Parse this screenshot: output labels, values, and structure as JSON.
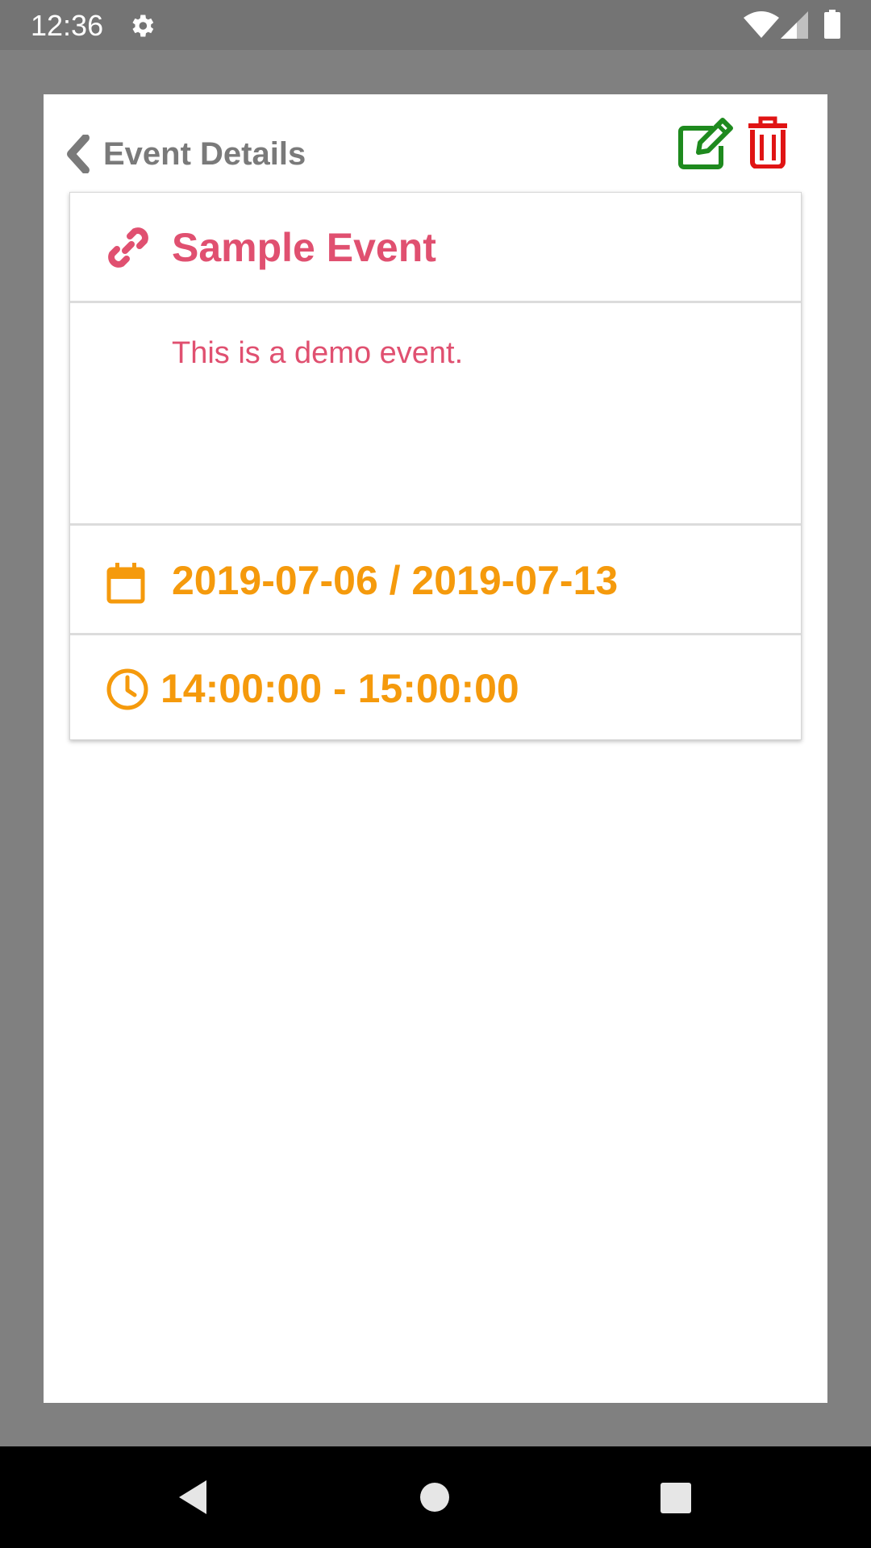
{
  "status_bar": {
    "time": "12:36",
    "icons": [
      "gear-icon",
      "wifi-icon",
      "signal-icon",
      "battery-icon"
    ]
  },
  "header": {
    "back_icon": "chevron-left-icon",
    "title": "Event Details",
    "edit_icon": "edit-icon",
    "delete_icon": "trash-icon"
  },
  "event": {
    "title": "Sample Event",
    "description": "This is a demo event.",
    "date_range": "2019-07-06 / 2019-07-13",
    "time_range": "14:00:00 - 15:00:00"
  },
  "colors": {
    "title_pink": "#e05070",
    "date_orange": "#f59a0c",
    "edit_green": "#1e8a1e",
    "delete_red": "#e01414",
    "header_gray": "#7a7a7a"
  },
  "nav_bar": {
    "buttons": [
      "back-triangle-icon",
      "home-circle-icon",
      "recents-square-icon"
    ]
  }
}
